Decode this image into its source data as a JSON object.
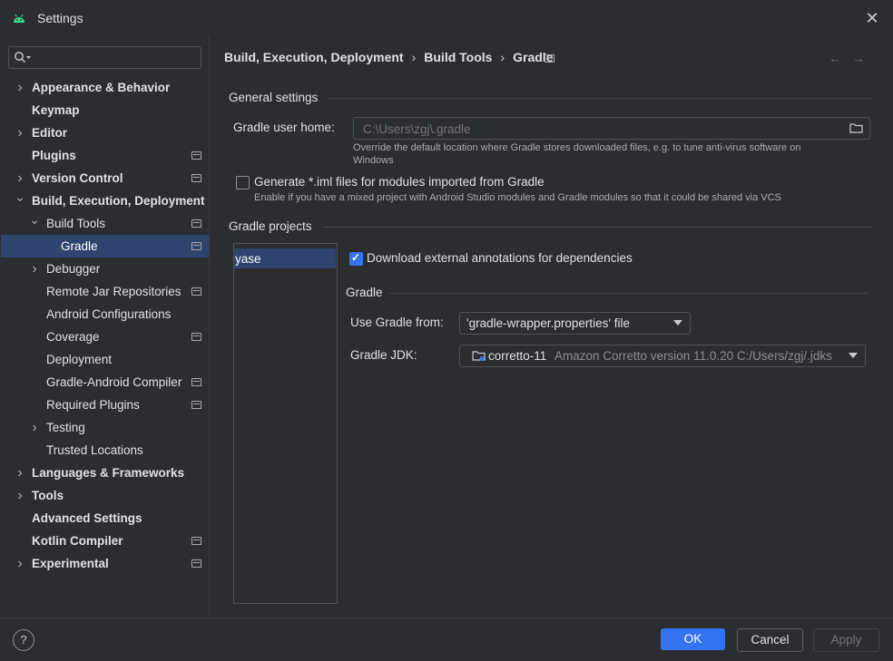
{
  "window": {
    "title": "Settings",
    "app_icon": "android-icon",
    "close_glyph": "✕"
  },
  "search": {
    "placeholder": ""
  },
  "sidebar": {
    "items": [
      {
        "label": "Appearance & Behavior",
        "bold": true,
        "chevron": "right",
        "level": 0,
        "pinned": false
      },
      {
        "label": "Keymap",
        "bold": true,
        "chevron": "",
        "level": 0,
        "pinned": false
      },
      {
        "label": "Editor",
        "bold": true,
        "chevron": "right",
        "level": 0,
        "pinned": false
      },
      {
        "label": "Plugins",
        "bold": true,
        "chevron": "",
        "level": 0,
        "pinned": true
      },
      {
        "label": "Version Control",
        "bold": true,
        "chevron": "right",
        "level": 0,
        "pinned": true
      },
      {
        "label": "Build, Execution, Deployment",
        "bold": true,
        "chevron": "down",
        "level": 0,
        "pinned": false
      },
      {
        "label": "Build Tools",
        "bold": false,
        "chevron": "down",
        "level": 1,
        "pinned": true
      },
      {
        "label": "Gradle",
        "bold": false,
        "chevron": "",
        "level": 2,
        "pinned": true,
        "selected": true
      },
      {
        "label": "Debugger",
        "bold": false,
        "chevron": "right",
        "level": 1,
        "pinned": false
      },
      {
        "label": "Remote Jar Repositories",
        "bold": false,
        "chevron": "",
        "level": 1,
        "pinned": true
      },
      {
        "label": "Android Configurations",
        "bold": false,
        "chevron": "",
        "level": 1,
        "pinned": false
      },
      {
        "label": "Coverage",
        "bold": false,
        "chevron": "",
        "level": 1,
        "pinned": true
      },
      {
        "label": "Deployment",
        "bold": false,
        "chevron": "",
        "level": 1,
        "pinned": false
      },
      {
        "label": "Gradle-Android Compiler",
        "bold": false,
        "chevron": "",
        "level": 1,
        "pinned": true
      },
      {
        "label": "Required Plugins",
        "bold": false,
        "chevron": "",
        "level": 1,
        "pinned": true
      },
      {
        "label": "Testing",
        "bold": false,
        "chevron": "right",
        "level": 1,
        "pinned": false
      },
      {
        "label": "Trusted Locations",
        "bold": false,
        "chevron": "",
        "level": 1,
        "pinned": false
      },
      {
        "label": "Languages & Frameworks",
        "bold": true,
        "chevron": "right",
        "level": 0,
        "pinned": false
      },
      {
        "label": "Tools",
        "bold": true,
        "chevron": "right",
        "level": 0,
        "pinned": false
      },
      {
        "label": "Advanced Settings",
        "bold": true,
        "chevron": "",
        "level": 0,
        "pinned": false
      },
      {
        "label": "Kotlin Compiler",
        "bold": true,
        "chevron": "",
        "level": 0,
        "pinned": true
      },
      {
        "label": "Experimental",
        "bold": true,
        "chevron": "right",
        "level": 0,
        "pinned": true
      }
    ]
  },
  "breadcrumb": {
    "parts": [
      "Build, Execution, Deployment",
      "Build Tools",
      "Gradle"
    ],
    "separator": "›",
    "back_glyph": "←",
    "forward_glyph": "→"
  },
  "general": {
    "section_title": "General settings",
    "user_home_label": "Gradle user home:",
    "user_home_placeholder": "C:\\Users\\zgj\\.gradle",
    "user_home_hint_line1": "Override the default location where Gradle stores downloaded files, e.g. to tune anti-virus software on",
    "user_home_hint_line2": "Windows",
    "iml_label": "Generate *.iml files for modules imported from Gradle",
    "iml_checked": false,
    "iml_hint": "Enable if you have a mixed project with Android Studio modules and Gradle modules so that it could be shared via VCS"
  },
  "projects": {
    "section_title": "Gradle projects",
    "list": [
      "yase"
    ],
    "download_annotations_label": "Download external annotations for dependencies",
    "download_annotations_checked": true,
    "gradle_section_title": "Gradle",
    "use_gradle_from_label": "Use Gradle from:",
    "use_gradle_from_value": "'gradle-wrapper.properties' file",
    "jdk_label": "Gradle JDK:",
    "jdk_name": "corretto-11",
    "jdk_detail": "Amazon Corretto version 11.0.20 C:/Users/zgj/.jdks"
  },
  "footer": {
    "help_glyph": "?",
    "ok_label": "OK",
    "cancel_label": "Cancel",
    "apply_label": "Apply"
  }
}
